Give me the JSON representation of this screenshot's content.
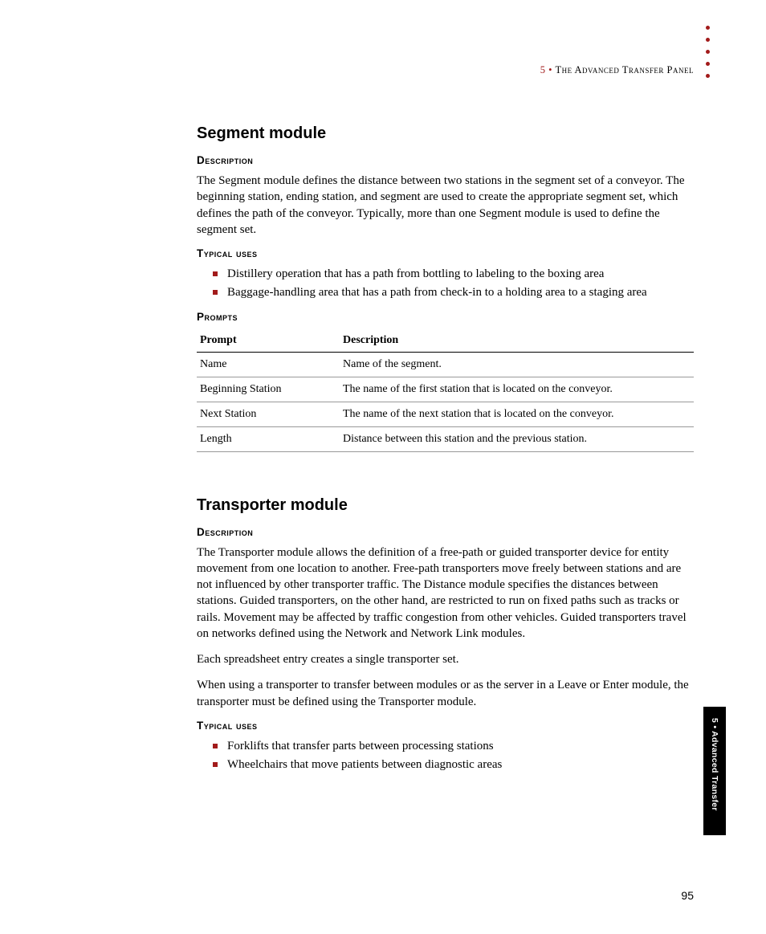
{
  "header": {
    "chapter": "5 • ",
    "title": "The Advanced Transfer Panel"
  },
  "segment": {
    "heading": "Segment module",
    "desc_head": "Description",
    "desc_body": "The Segment module defines the distance between two stations in the segment set of a conveyor. The beginning station, ending station, and segment are used to create the appropriate segment set, which defines the path of the conveyor. Typically, more than one Segment module is used to define the segment set.",
    "uses_head": "Typical uses",
    "uses": [
      "Distillery operation that has a path from bottling to labeling to the boxing area",
      "Baggage-handling area that has a path from check-in to a holding area to a staging area"
    ],
    "prompts_head": "Prompts",
    "table": {
      "col1": "Prompt",
      "col2": "Description",
      "rows": [
        {
          "p": "Name",
          "d": "Name of the segment."
        },
        {
          "p": "Beginning Station",
          "d": "The name of the first station that is located on the conveyor."
        },
        {
          "p": "Next Station",
          "d": "The name of the next station that is located on the conveyor."
        },
        {
          "p": "Length",
          "d": "Distance between this station and the previous station."
        }
      ]
    }
  },
  "transporter": {
    "heading": "Transporter module",
    "desc_head": "Description",
    "desc_body1": "The Transporter module allows the definition of a free-path or guided transporter device for entity movement from one location to another. Free-path transporters move freely between stations and are not influenced by other transporter traffic. The Distance module specifies the distances between stations. Guided transporters, on the other hand, are restricted to run on fixed paths such as tracks or rails. Movement may be affected by traffic congestion from other vehicles. Guided transporters travel on networks defined using the Network and Network Link modules.",
    "desc_body2": "Each spreadsheet entry creates a single transporter set.",
    "desc_body3": "When using a transporter to transfer between modules or as the server in a Leave or Enter module, the transporter must be defined using the Transporter module.",
    "uses_head": "Typical uses",
    "uses": [
      "Forklifts that transfer parts between processing stations",
      "Wheelchairs that move patients between diagnostic areas"
    ]
  },
  "sideTab": "5 • Advanced Transfer",
  "pageNumber": "95"
}
